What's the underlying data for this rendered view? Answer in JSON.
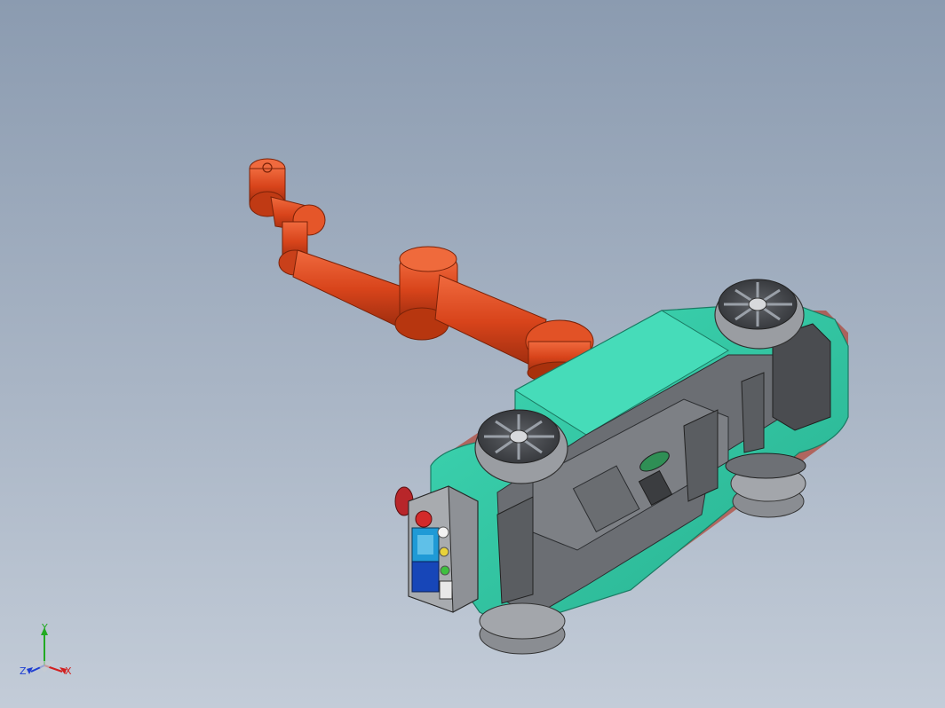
{
  "viewport": {
    "background_top": "#8b9bb0",
    "background_bottom": "#c3ccd8"
  },
  "model": {
    "arm_color": "#e0471c",
    "body_color": "#34c9a6",
    "chassis_color": "#6f7277",
    "wheel_color": "#8a8d92",
    "control_box": {
      "buttons": [
        "red-stop-button",
        "blue-display",
        "blue-panel",
        "white-button",
        "yellow-button",
        "green-button",
        "switch"
      ]
    }
  },
  "triad": {
    "x_label": "X",
    "y_label": "Y",
    "z_label": "Z",
    "x_color": "#d21f1f",
    "y_color": "#22aa22",
    "z_color": "#1f3fd2"
  }
}
